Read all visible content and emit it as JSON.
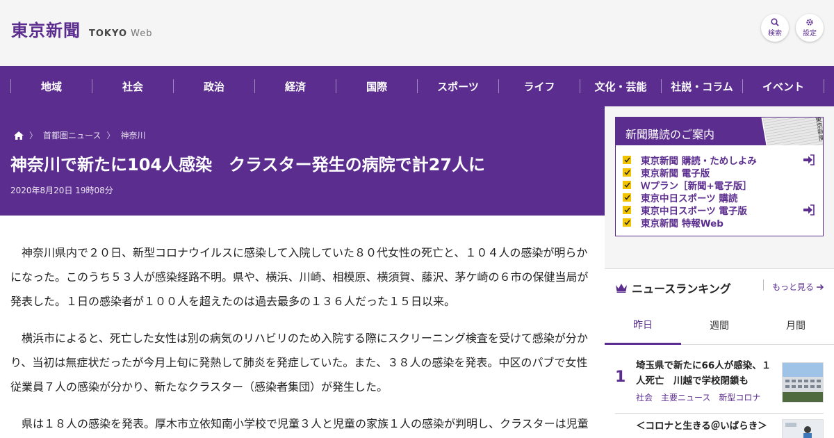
{
  "header": {
    "logo_jp": "東京新聞",
    "logo_en_bold": "TOKYO",
    "logo_en_light": "Web",
    "search_label": "検索",
    "settings_label": "設定"
  },
  "nav": {
    "items": [
      "地域",
      "社会",
      "政治",
      "経済",
      "国際",
      "スポーツ",
      "ライフ",
      "文化・芸能",
      "社説・コラム",
      "イベント"
    ]
  },
  "article": {
    "breadcrumb": [
      "首都圏ニュース",
      "神奈川"
    ],
    "title": "神奈川で新たに104人感染　クラスター発生の病院で計27人に",
    "date": "2020年8月20日 19時08分",
    "paragraphs": [
      "神奈川県内で２０日、新型コロナウイルスに感染して入院していた８０代女性の死亡と、１０４人の感染が明らかになった。このうち５３人が感染経路不明。県や、横浜、川崎、相模原、横須賀、藤沢、茅ケ崎の６市の保健当局が発表した。１日の感染者が１００人を超えたのは過去最多の１３６人だった１５日以来。",
      "横浜市によると、死亡した女性は別の病気のリハビリのため入院する際にスクリーニング検査を受けて感染が分かり、当初は無症状だったが今月上旬に発熱して肺炎を発症していた。また、３８人の感染を発表。中区のパブで女性従業員７人の感染が分かり、新たなクラスター（感染者集団）が発生した。",
      "県は１８人の感染を発表。厚木市立依知南小学校で児童３人と児童の家族１人の感染が判明し、クラスターは児童"
    ]
  },
  "promo": {
    "title": "新聞購読のご案内",
    "paper_text": "東京新聞",
    "items": [
      {
        "label": "東京新聞 購読・ためしよみ",
        "arrow": true
      },
      {
        "label": "東京新聞 電子版",
        "arrow": true
      },
      {
        "label": "Ｗプラン［新聞+電子版］",
        "arrow": false
      },
      {
        "label": "東京中日スポーツ 購読",
        "arrow": false
      },
      {
        "label": "東京中日スポーツ 電子版",
        "arrow": true
      },
      {
        "label": "東京新聞 特報Web",
        "arrow": false
      }
    ]
  },
  "ranking": {
    "title": "ニュースランキング",
    "more": "もっと見る",
    "tabs": [
      "昨日",
      "週間",
      "月間"
    ],
    "active_tab": "昨日",
    "items": [
      {
        "rank": "1",
        "title": "埼玉県で新たに66人が感染、１人死亡　川越で学校閉鎖も",
        "tags": [
          "社会",
          "主要ニュース",
          "新型コロナ"
        ]
      },
      {
        "rank": "",
        "title": "＜コロナと生きる＠いばらき＞",
        "tags": []
      }
    ]
  },
  "colors": {
    "brand": "#5b2d8e",
    "check": "#f2c400"
  }
}
